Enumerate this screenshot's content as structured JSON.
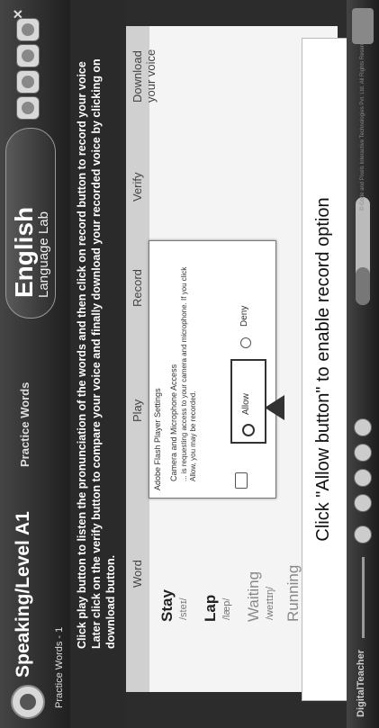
{
  "header": {
    "title": "Speaking/Level A1",
    "tab": "Practice Words",
    "brand_main": "English",
    "brand_sub": "Language Lab",
    "close_symbol": "×",
    "breadcrumb": "Practice Words - 1"
  },
  "instructions": {
    "line1": "Click play button to listen the pronunciation of the words and then click on record button to record your voice",
    "line2": "Later click on the verify button to compare your voice and finally download your recorded voice by clicking on",
    "line3": "download button."
  },
  "table": {
    "headers": [
      "Word",
      "Play",
      "Record",
      "Verify",
      "Download your voice"
    ],
    "words": [
      {
        "word": "Stay",
        "phonetic": "/steɪ/"
      },
      {
        "word": "Lap",
        "phonetic": "/læp/"
      },
      {
        "word": "Waiting",
        "phonetic": "/weɪtɪŋ/"
      },
      {
        "word": "Running",
        "phonetic": ""
      }
    ]
  },
  "dialog": {
    "title": "Adobe Flash Player Settings",
    "badge": "",
    "subtitle": "Camera and Microphone Access",
    "body": "... is requesting access to your camera and microphone. If you click Allow, you may be recorded.",
    "allow_label": "Allow",
    "deny_label": "Deny"
  },
  "caption": "Click \"Allow button\" to enable record option",
  "footer": {
    "brand": "DigitalTeacher",
    "copyright": "© Code and Pixels Interactive Technologies Pvt. Ltd. All Rights Reserved."
  },
  "progress": {
    "value": 0.35
  },
  "icons": {
    "logo": "logo-icon",
    "header_buttons": [
      "settings-icon",
      "help-icon",
      "sound-icon",
      "info-icon"
    ],
    "dialog_camera": "camera-icon",
    "arrow": "arrow-up-icon",
    "footer_controls": [
      "previous-icon",
      "play-icon",
      "next-icon",
      "volume-icon",
      "replay-icon"
    ]
  },
  "colors": {
    "header_bg": "#2c2c2c",
    "table_bg": "#f4f4f4",
    "dialog_border": "#777777"
  }
}
